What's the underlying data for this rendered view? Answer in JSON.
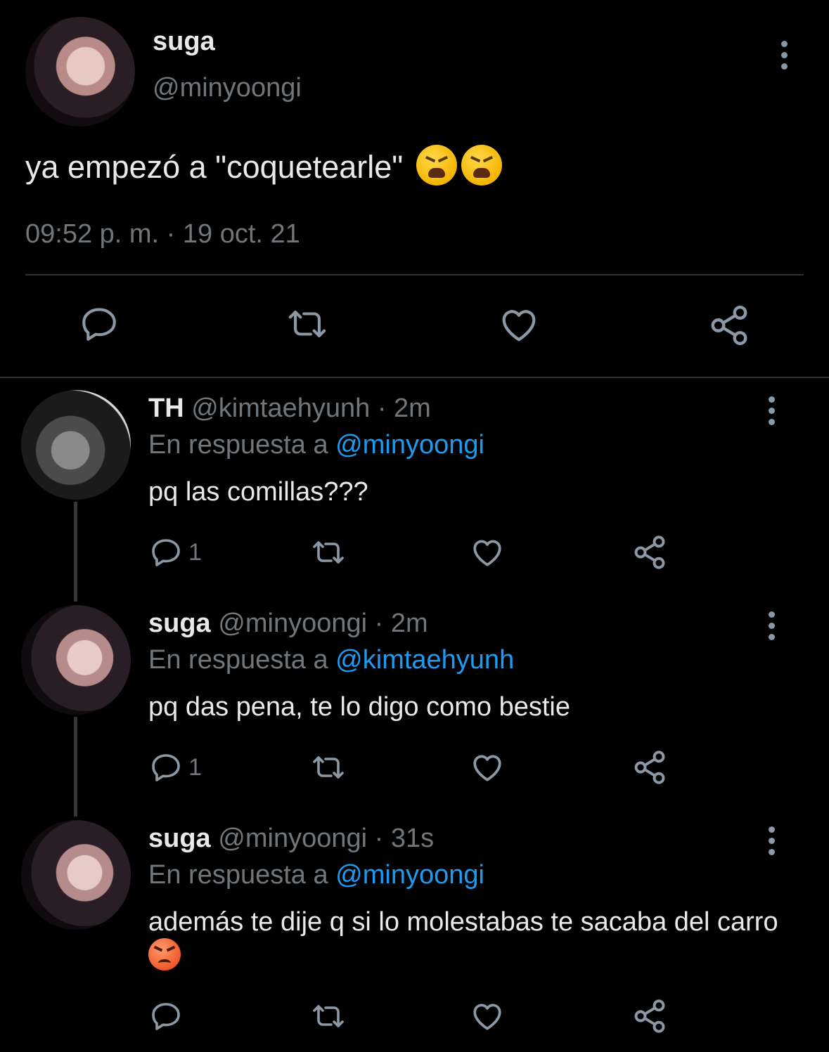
{
  "main_tweet": {
    "name": "suga",
    "handle": "@minyoongi",
    "text": "ya empezó a \"coquetearle\"",
    "emoji": [
      "tired-face-emoji",
      "tired-face-emoji"
    ],
    "timestamp": "09:52 p. m. · 19 oct. 21"
  },
  "replies": [
    {
      "name": "TH",
      "handle": "@kimtaehyunh",
      "time": "· 2m",
      "reply_prefix": "En respuesta a",
      "reply_to": "@minyoongi",
      "text": "pq las comillas???",
      "reply_count": "1"
    },
    {
      "name": "suga",
      "handle": "@minyoongi",
      "time": "· 2m",
      "reply_prefix": "En respuesta a",
      "reply_to": "@kimtaehyunh",
      "text": "pq das pena, te lo digo como bestie",
      "reply_count": "1"
    },
    {
      "name": "suga",
      "handle": "@minyoongi",
      "time": "· 31s",
      "reply_prefix": "En respuesta a",
      "reply_to": "@minyoongi",
      "text": "además te dije q si lo molestabas te sacaba del carro",
      "emoji": "angry-face-emoji",
      "reply_count": ""
    }
  ],
  "colors": {
    "background": "#000000",
    "text": "#e7e9ea",
    "secondary": "#71767b",
    "mention": "#1d9bf0",
    "divider": "#2f3336"
  }
}
